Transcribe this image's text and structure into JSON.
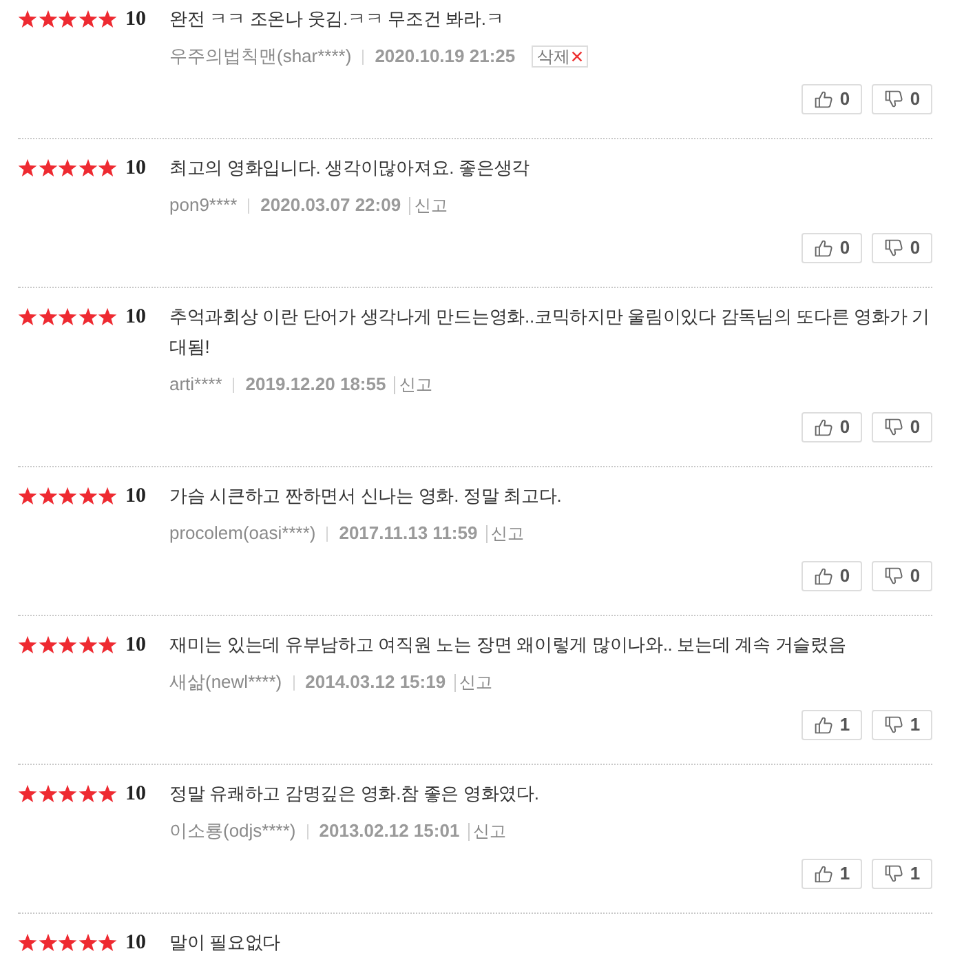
{
  "reviews": [
    {
      "stars": 5,
      "score": "10",
      "text": "완전 ㅋㅋ 조온나 웃김.ㅋㅋ 무조건 봐라.ㅋ",
      "author": "우주의법칙맨(shar****)",
      "date": "2020.10.19 21:25",
      "action": {
        "kind": "delete",
        "label": "삭제"
      },
      "likes": "0",
      "dislikes": "0"
    },
    {
      "stars": 5,
      "score": "10",
      "text": "최고의 영화입니다. 생각이많아져요. 좋은생각",
      "author": "pon9****",
      "date": "2020.03.07 22:09",
      "action": {
        "kind": "report",
        "label": "신고"
      },
      "likes": "0",
      "dislikes": "0"
    },
    {
      "stars": 5,
      "score": "10",
      "text": "추억과회상 이란 단어가 생각나게 만드는영화..코믹하지만 울림이있다 감독님의 또다른 영화가 기대됨!",
      "author": "arti****",
      "date": "2019.12.20 18:55",
      "action": {
        "kind": "report",
        "label": "신고"
      },
      "likes": "0",
      "dislikes": "0"
    },
    {
      "stars": 5,
      "score": "10",
      "text": "가슴 시큰하고 짠하면서 신나는 영화. 정말 최고다.",
      "author": "procolem(oasi****)",
      "date": "2017.11.13 11:59",
      "action": {
        "kind": "report",
        "label": "신고"
      },
      "likes": "0",
      "dislikes": "0"
    },
    {
      "stars": 5,
      "score": "10",
      "text": "재미는 있는데 유부남하고 여직원 노는 장면 왜이렇게 많이나와.. 보는데 계속 거슬렸음",
      "author": "새삶(newl****)",
      "date": "2014.03.12 15:19",
      "action": {
        "kind": "report",
        "label": "신고"
      },
      "likes": "1",
      "dislikes": "1"
    },
    {
      "stars": 5,
      "score": "10",
      "text": "정말 유쾌하고 감명깊은 영화.참 좋은 영화였다.",
      "author": "이소룡(odjs****)",
      "date": "2013.02.12 15:01",
      "action": {
        "kind": "report",
        "label": "신고"
      },
      "likes": "1",
      "dislikes": "1"
    },
    {
      "stars": 5,
      "score": "10",
      "text": "말이 필요없다"
    }
  ]
}
